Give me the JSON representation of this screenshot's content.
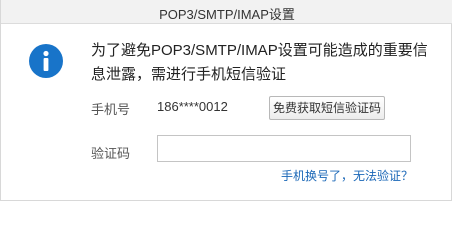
{
  "window": {
    "title": "POP3/SMTP/IMAP设置"
  },
  "notice": {
    "icon": "info-icon",
    "icon_color": "#1874c9",
    "message": "为了避免POP3/SMTP/IMAP设置可能造成的重要信息泄露，需进行手机短信验证"
  },
  "phone": {
    "label": "手机号",
    "value": "186****0012",
    "get_code_label": "免费获取短信验证码"
  },
  "verification": {
    "label": "验证码",
    "value": "",
    "placeholder": ""
  },
  "help_link": "手机换号了，无法验证？",
  "colors": {
    "link": "#1a67b7",
    "titlebar_bg": "#f2f2f2"
  }
}
